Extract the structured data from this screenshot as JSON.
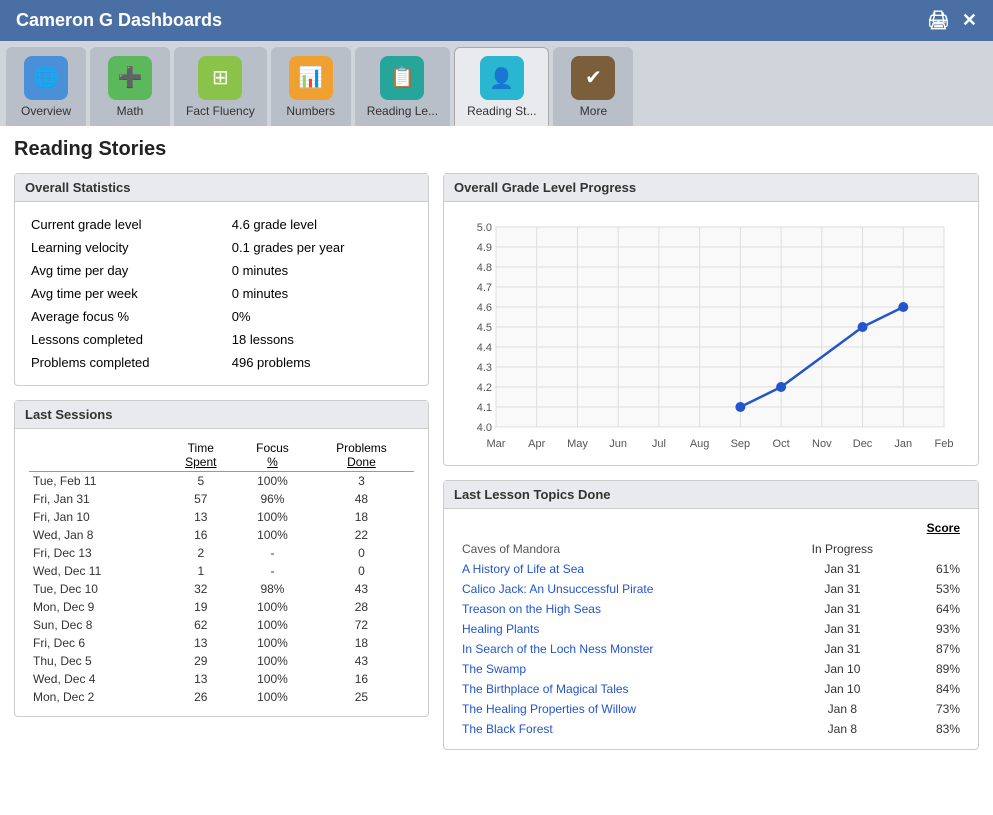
{
  "titleBar": {
    "title": "Cameron G Dashboards",
    "printIcon": "🖨",
    "closeIcon": "✕"
  },
  "navTabs": [
    {
      "id": "overview",
      "label": "Overview",
      "iconColor": "icon-blue",
      "icon": "🌐",
      "active": false
    },
    {
      "id": "math",
      "label": "Math",
      "iconColor": "icon-green",
      "icon": "➕",
      "active": false
    },
    {
      "id": "fact-fluency",
      "label": "Fact Fluency",
      "iconColor": "icon-lime",
      "icon": "⊞",
      "active": false
    },
    {
      "id": "numbers",
      "label": "Numbers",
      "iconColor": "icon-orange",
      "icon": "📊",
      "active": false
    },
    {
      "id": "reading-level",
      "label": "Reading Le...",
      "iconColor": "icon-teal",
      "icon": "📋",
      "active": false
    },
    {
      "id": "reading-stories",
      "label": "Reading St...",
      "iconColor": "icon-cyan",
      "icon": "👤",
      "active": true
    },
    {
      "id": "more",
      "label": "More",
      "iconColor": "icon-brown",
      "icon": "✔",
      "active": false
    }
  ],
  "pageTitle": "Reading Stories",
  "overallStats": {
    "header": "Overall Statistics",
    "rows": [
      {
        "label": "Current grade level",
        "value": "4.6 grade level"
      },
      {
        "label": "Learning velocity",
        "value": "0.1 grades per year"
      },
      {
        "label": "Avg time per day",
        "value": "0 minutes"
      },
      {
        "label": "Avg time per week",
        "value": "0 minutes"
      },
      {
        "label": "Average focus %",
        "value": "0%"
      },
      {
        "label": "Lessons completed",
        "value": "18 lessons"
      },
      {
        "label": "Problems completed",
        "value": "496 problems"
      }
    ]
  },
  "lastSessions": {
    "header": "Last Sessions",
    "columns": [
      "",
      "Time Spent",
      "Focus %",
      "Problems Done"
    ],
    "rows": [
      {
        "date": "Tue, Feb 11",
        "time": "5",
        "focus": "100%",
        "problems": "3"
      },
      {
        "date": "Fri, Jan 31",
        "time": "57",
        "focus": "96%",
        "problems": "48"
      },
      {
        "date": "Fri, Jan 10",
        "time": "13",
        "focus": "100%",
        "problems": "18"
      },
      {
        "date": "Wed, Jan 8",
        "time": "16",
        "focus": "100%",
        "problems": "22"
      },
      {
        "date": "Fri, Dec 13",
        "time": "2",
        "focus": "-",
        "problems": "0"
      },
      {
        "date": "Wed, Dec 11",
        "time": "1",
        "focus": "-",
        "problems": "0"
      },
      {
        "date": "Tue, Dec 10",
        "time": "32",
        "focus": "98%",
        "problems": "43"
      },
      {
        "date": "Mon, Dec 9",
        "time": "19",
        "focus": "100%",
        "problems": "28"
      },
      {
        "date": "Sun, Dec 8",
        "time": "62",
        "focus": "100%",
        "problems": "72"
      },
      {
        "date": "Fri, Dec 6",
        "time": "13",
        "focus": "100%",
        "problems": "18"
      },
      {
        "date": "Thu, Dec 5",
        "time": "29",
        "focus": "100%",
        "problems": "43"
      },
      {
        "date": "Wed, Dec 4",
        "time": "13",
        "focus": "100%",
        "problems": "16"
      },
      {
        "date": "Mon, Dec 2",
        "time": "26",
        "focus": "100%",
        "problems": "25"
      }
    ]
  },
  "gradeChart": {
    "header": "Overall Grade Level Progress",
    "yMin": 4.0,
    "yMax": 5.0,
    "yLabels": [
      "5.0",
      "4.9",
      "4.8",
      "4.7",
      "4.6",
      "4.5",
      "4.4",
      "4.3",
      "4.2",
      "4.1",
      "4.0"
    ],
    "xLabels": [
      "Mar",
      "Apr",
      "May",
      "Jun",
      "Jul",
      "Aug",
      "Sep",
      "Oct",
      "Nov",
      "Dec",
      "Jan",
      "Feb"
    ],
    "dataPoints": [
      {
        "x": "Sep",
        "y": 4.1
      },
      {
        "x": "Oct",
        "y": 4.2
      },
      {
        "x": "Dec",
        "y": 4.5
      },
      {
        "x": "Jan",
        "y": 4.6
      }
    ]
  },
  "lastLessons": {
    "header": "Last Lesson Topics Done",
    "scoreLabel": "Score",
    "rows": [
      {
        "title": "Caves of Mandora",
        "isLink": false,
        "date": "",
        "dateLabel": "In Progress",
        "score": ""
      },
      {
        "title": "A History of Life at Sea",
        "isLink": true,
        "date": "Jan 31",
        "score": "61%"
      },
      {
        "title": "Calico Jack: An Unsuccessful Pirate",
        "isLink": true,
        "date": "Jan 31",
        "score": "53%"
      },
      {
        "title": "Treason on the High Seas",
        "isLink": true,
        "date": "Jan 31",
        "score": "64%"
      },
      {
        "title": "Healing Plants",
        "isLink": true,
        "date": "Jan 31",
        "score": "93%"
      },
      {
        "title": "In Search of the Loch Ness Monster",
        "isLink": true,
        "date": "Jan 31",
        "score": "87%"
      },
      {
        "title": "The Swamp",
        "isLink": true,
        "date": "Jan 10",
        "score": "89%"
      },
      {
        "title": "The Birthplace of Magical Tales",
        "isLink": true,
        "date": "Jan 10",
        "score": "84%"
      },
      {
        "title": "The Healing Properties of Willow",
        "isLink": true,
        "date": "Jan 8",
        "score": "73%"
      },
      {
        "title": "The Black Forest",
        "isLink": true,
        "date": "Jan 8",
        "score": "83%"
      }
    ]
  }
}
